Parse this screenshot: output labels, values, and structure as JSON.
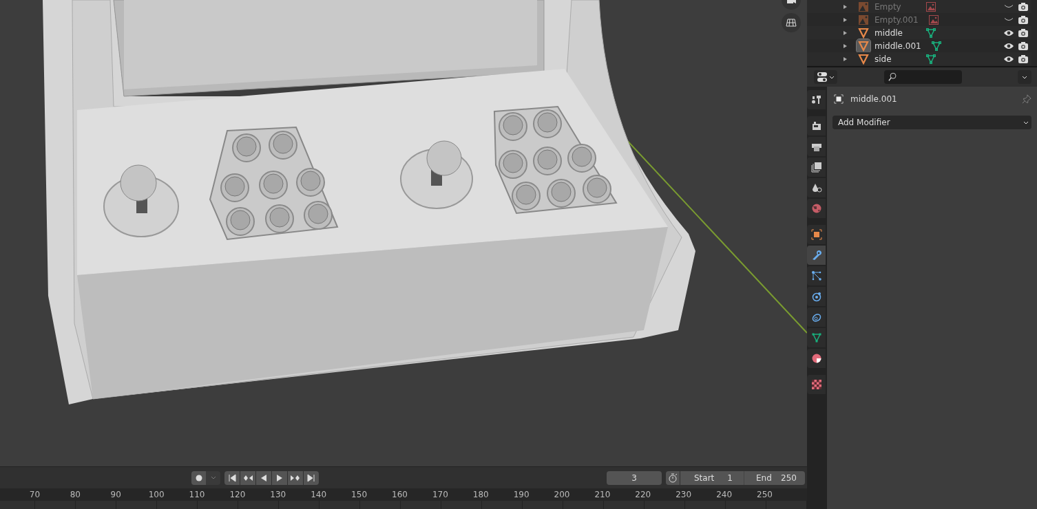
{
  "outliner": {
    "rows": [
      {
        "name": "Empty",
        "kind": "empty",
        "active": false,
        "visible": false
      },
      {
        "name": "Empty.001",
        "kind": "empty",
        "active": false,
        "visible": false
      },
      {
        "name": "middle",
        "kind": "mesh",
        "active": false,
        "visible": true
      },
      {
        "name": "middle.001",
        "kind": "mesh",
        "active": true,
        "visible": true
      },
      {
        "name": "side",
        "kind": "mesh",
        "active": false,
        "visible": true
      }
    ]
  },
  "properties": {
    "tabs": [
      {
        "kind": "tool",
        "selected": false
      },
      {
        "kind": "render",
        "selected": false
      },
      {
        "kind": "output",
        "selected": false
      },
      {
        "kind": "view-layer",
        "selected": false
      },
      {
        "kind": "scene",
        "selected": false
      },
      {
        "kind": "world",
        "selected": false
      },
      {
        "kind": "object",
        "selected": false
      },
      {
        "kind": "modifier",
        "selected": true
      },
      {
        "kind": "particles",
        "selected": false
      },
      {
        "kind": "physics",
        "selected": false
      },
      {
        "kind": "constraints",
        "selected": false
      },
      {
        "kind": "data",
        "selected": false
      },
      {
        "kind": "material",
        "selected": false
      },
      {
        "kind": "texture",
        "selected": false
      }
    ],
    "object_name": "middle.001",
    "add_modifier": "Add Modifier"
  },
  "timeline": {
    "current_frame": "3",
    "start_label": "Start",
    "start": "1",
    "end_label": "End",
    "end": "250",
    "ruler": [
      "70",
      "80",
      "90",
      "100",
      "110",
      "120",
      "130",
      "140",
      "150",
      "160",
      "170",
      "180",
      "190",
      "200",
      "210",
      "220",
      "230",
      "240",
      "250"
    ]
  }
}
